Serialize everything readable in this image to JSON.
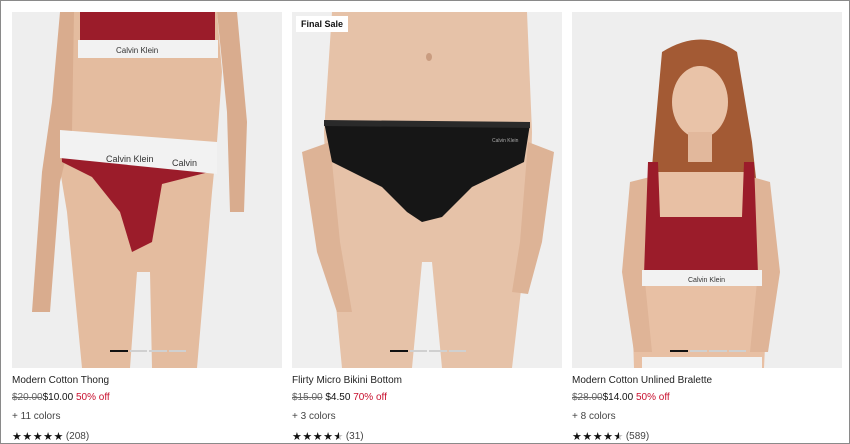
{
  "products": [
    {
      "name": "Modern Cotton Thong",
      "badge": "",
      "was_price": "$20.00",
      "now_price": "$10.00",
      "discount": "50% off",
      "colors": "+ 11 colors",
      "stars": "★★★★★",
      "half_star": "",
      "review_count": "(208)",
      "rating": 5,
      "image": "model-red-thong",
      "accent": "#9b1c2a"
    },
    {
      "name": "Flirty Micro Bikini Bottom",
      "badge": "Final Sale",
      "was_price": "$15.00",
      "now_price": "$4.50",
      "discount": "70% off",
      "colors": "+ 3 colors",
      "stars": "★★★★",
      "half_star": "★",
      "review_count": "(31)",
      "rating": 4.5,
      "image": "model-black-bikini",
      "accent": "#151515"
    },
    {
      "name": "Modern Cotton Unlined Bralette",
      "badge": "",
      "was_price": "$28.00",
      "now_price": "$14.00",
      "discount": "50% off",
      "colors": "+ 8 colors",
      "stars": "★★★★",
      "half_star": "★",
      "review_count": "(589)",
      "rating": 4.5,
      "image": "model-red-bralette",
      "accent": "#9b1c2a"
    }
  ],
  "colors": {
    "sale_red": "#c8102e",
    "waistband": "#eeeeee",
    "skin": "#e2b79d"
  }
}
